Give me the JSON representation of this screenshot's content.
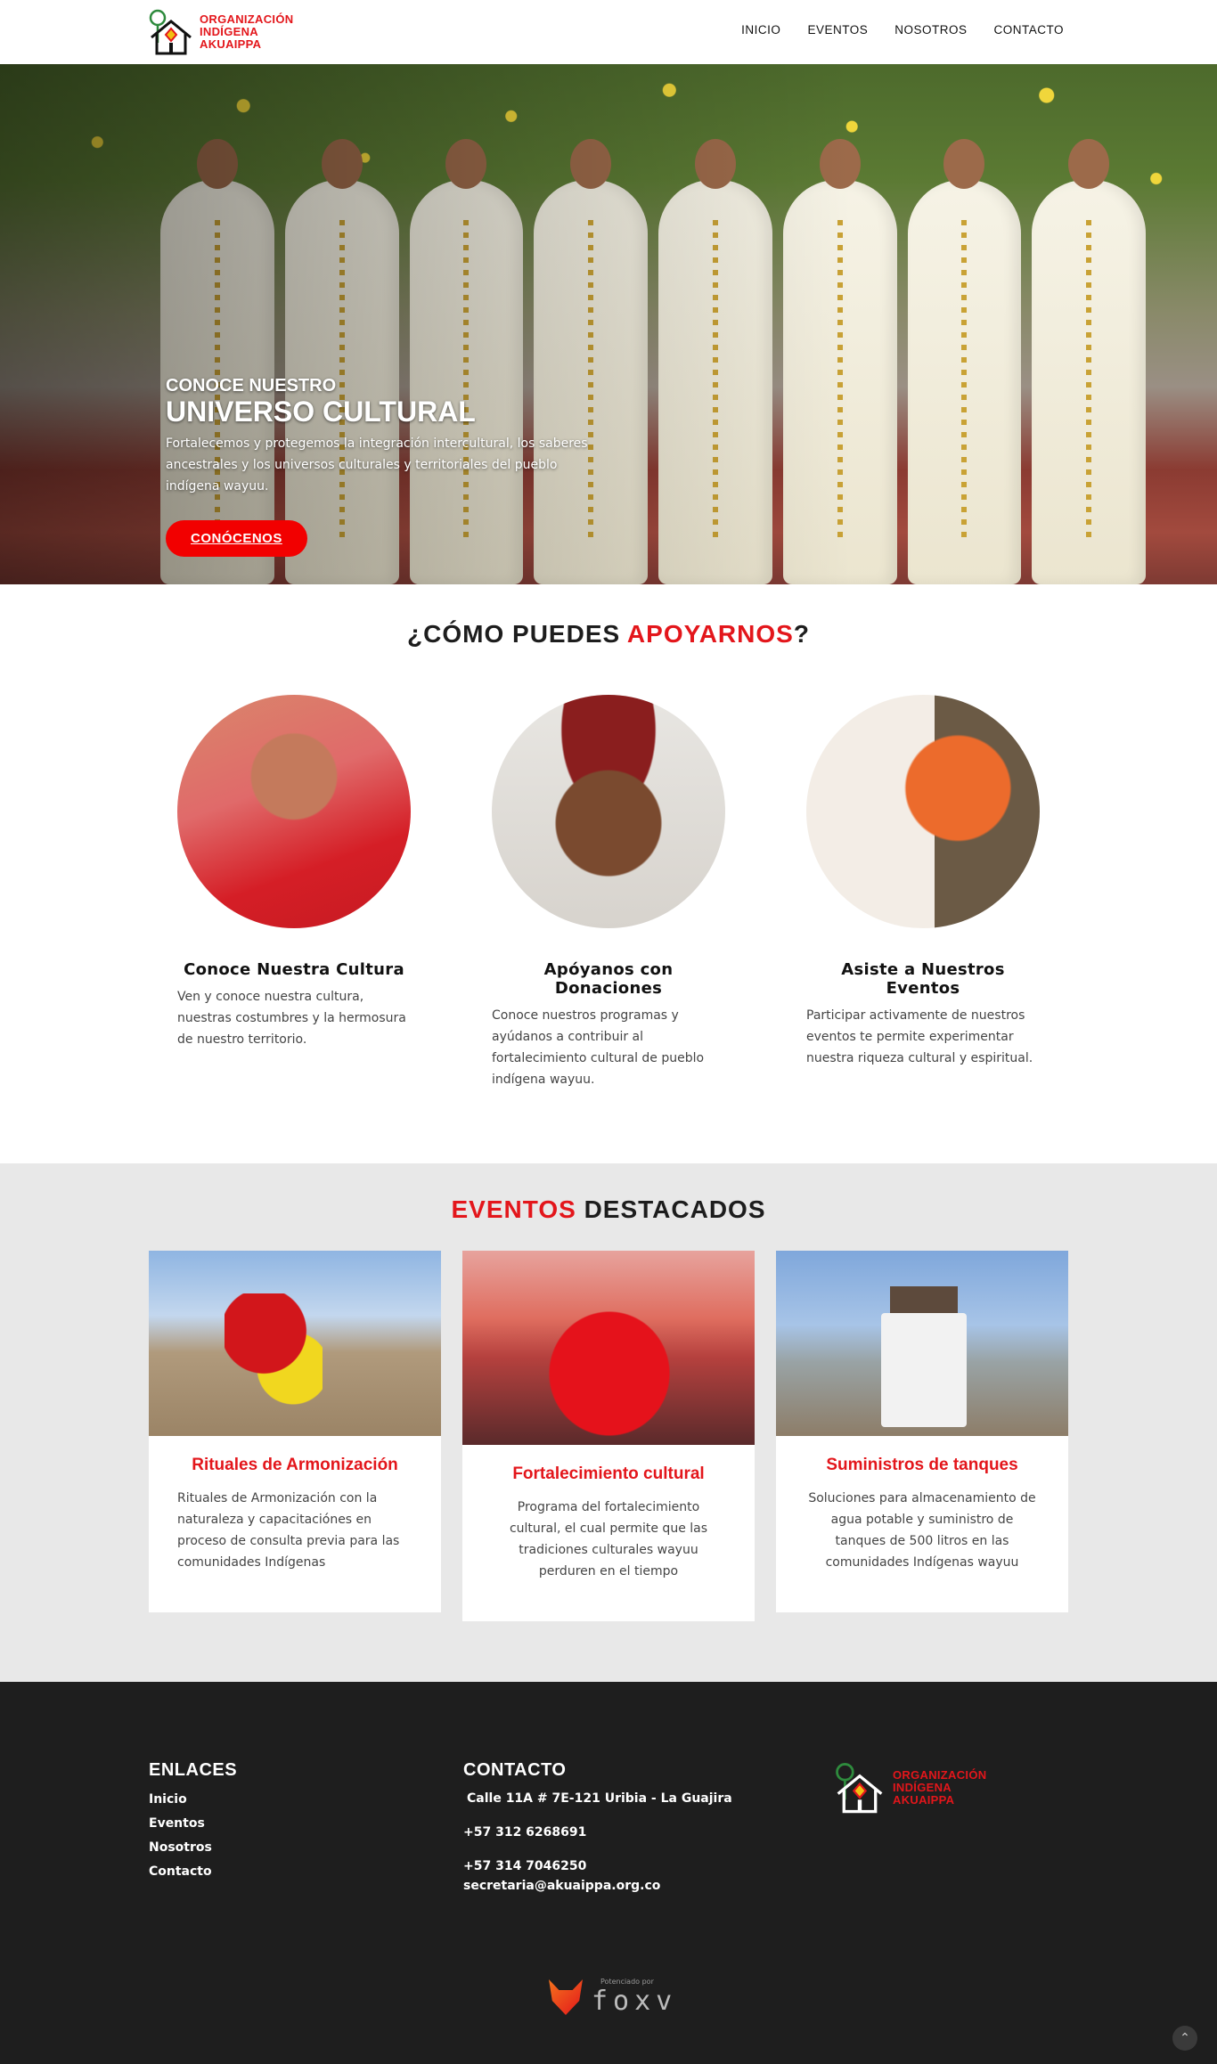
{
  "brand": {
    "line1": "ORGANIZACIÓN",
    "line2": "INDÍGENA",
    "line3": "AKUAIPPA",
    "accent_color": "#e3161b"
  },
  "nav": {
    "items": [
      "INICIO",
      "EVENTOS",
      "NOSOTROS",
      "CONTACTO"
    ]
  },
  "hero": {
    "kicker": "CONOCE NUESTRO",
    "title": "UNIVERSO CULTURAL",
    "text": "Fortalecemos y protegemos la integración intercultural, los saberes ancestrales y los universos culturales y territoriales del pueblo indígena wayuu.",
    "button": "CONÓCENOS"
  },
  "support": {
    "title_before": "¿CÓMO PUEDES ",
    "title_highlight": "APOYARNOS",
    "title_after": "?",
    "cards": [
      {
        "title": "Conoce Nuestra Cultura",
        "text": "Ven y conoce nuestra cultura, nuestras costumbres y la hermosura de nuestro territorio."
      },
      {
        "title": "Apóyanos con Donaciones",
        "text": "Conoce nuestros programas y ayúdanos a contribuir al fortalecimiento cultural de pueblo indígena wayuu."
      },
      {
        "title": "Asiste a Nuestros Eventos",
        "text": "Participar activamente de nuestros eventos te permite experimentar nuestra riqueza cultural y espiritual."
      }
    ]
  },
  "events": {
    "title_highlight": "EVENTOS",
    "title_rest": " DESTACADOS",
    "cards": [
      {
        "title": "Rituales de Armonización",
        "text": "Rituales de Armonización con la naturaleza y capacitaciónes en proceso de consulta previa para las comunidades Indígenas"
      },
      {
        "title": "Fortalecimiento cultural",
        "text": "Programa del fortalecimiento cultural, el cual permite que las tradiciones culturales wayuu perduren en el tiempo"
      },
      {
        "title": "Suministros de tanques",
        "text": "Soluciones para almacenamiento de agua potable y suministro de tanques de 500 litros en las comunidades Indígenas wayuu"
      }
    ]
  },
  "footer": {
    "links_title": "ENLACES",
    "links": [
      "Inicio",
      "Eventos",
      "Nosotros",
      "Contacto"
    ],
    "contact_title": "CONTACTO",
    "address": "Calle 11A # 7E-121 Uribia - La Guajira",
    "phone1": "+57 312 6268691",
    "phone2": "+57 314 7046250",
    "email": "secretaria@akuaippa.org.co",
    "powered_by": "Potenciado por",
    "powered_name": "foxv"
  }
}
